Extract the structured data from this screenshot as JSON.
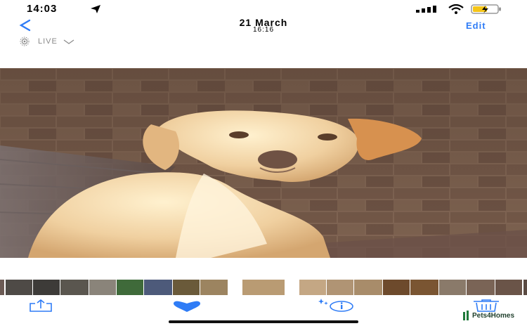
{
  "status_bar": {
    "time": "14:03"
  },
  "nav": {
    "back_icon": "chevron-left-icon",
    "title": "21 March",
    "subtitle": "16:16",
    "edit_label": "Edit"
  },
  "live": {
    "label": "LIVE"
  },
  "photo": {
    "subject": "dog-photo"
  },
  "colors": {
    "accent": "#2f7cf6",
    "background": "#ffffff"
  },
  "toolbar": {
    "share_icon": "share-icon",
    "favorite_icon": "heart-icon",
    "info_icon": "info-icon",
    "delete_icon": "trash-icon"
  },
  "watermark": {
    "text": "Pets4Homes"
  }
}
